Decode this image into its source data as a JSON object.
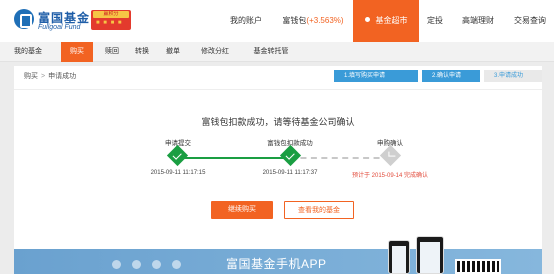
{
  "header": {
    "logo_name": "富国基金",
    "logo_en": "Fullgoal Fund",
    "badge_text": "赢积分",
    "nav": [
      {
        "label": "我的账户"
      },
      {
        "label": "富钱包",
        "extra": "(+3.563%)"
      },
      {
        "label": "基金超市"
      },
      {
        "label": "定投"
      },
      {
        "label": "高端理财"
      },
      {
        "label": "交易查询"
      }
    ]
  },
  "subnav": [
    "我的基金",
    "购买",
    "赎回",
    "转换",
    "撤单",
    "修改分红",
    "基金转托管"
  ],
  "breadcrumb": {
    "root": "购买",
    "sep": ">",
    "current": "申请成功"
  },
  "step_bar": [
    "1.填写购买申请",
    "2.确认申请",
    "3.申请成功"
  ],
  "headline": "富钱包扣款成功，请等待基金公司确认",
  "progress": [
    {
      "label": "申请提交",
      "time": "2015-09-11 11:17:15",
      "state": "done"
    },
    {
      "label": "富钱包扣款成功",
      "time": "2015-09-11 11:17:37",
      "state": "done"
    },
    {
      "label": "申购确认",
      "time": "预计于 2015-09-14 完成确认",
      "state": "pending"
    }
  ],
  "buttons": {
    "primary": "继续购买",
    "secondary": "查看我的基金"
  },
  "banner": {
    "title": "富国基金手机APP"
  },
  "colors": {
    "accent": "#f26322",
    "success": "#1a9e42",
    "step": "#3a9bd8",
    "brand": "#1f5ea8"
  }
}
